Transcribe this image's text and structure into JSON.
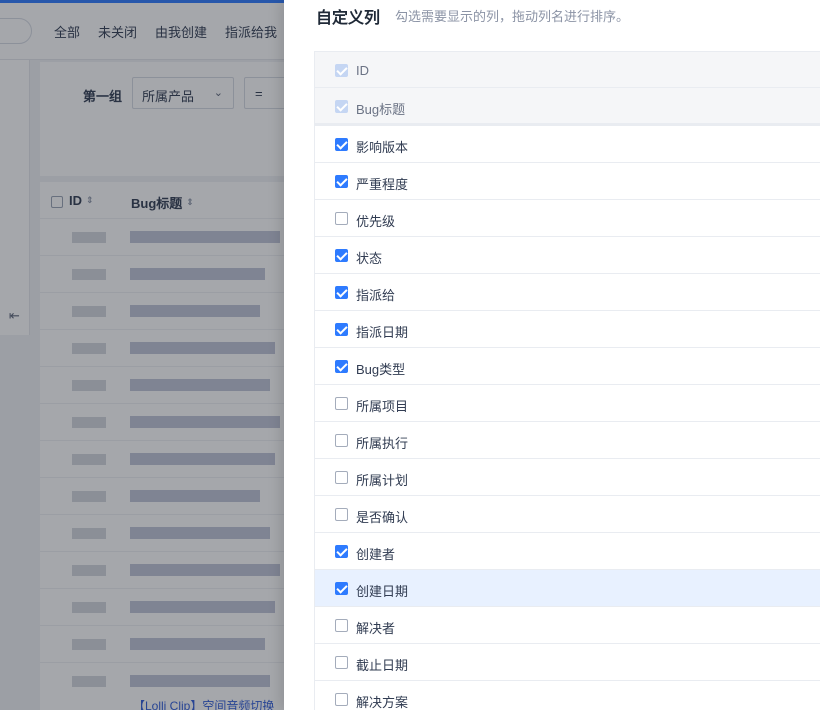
{
  "background": {
    "nav": [
      "全部",
      "未关闭",
      "由我创建",
      "指派给我"
    ],
    "filter": {
      "group_label": "第一组",
      "field_value": "所属产品",
      "operator_value": "="
    },
    "table": {
      "col_id": "ID",
      "col_title": "Bug标题",
      "last_row_title": "【Lolli Clip】空间音频切换"
    }
  },
  "drawer": {
    "title": "自定义列",
    "hint": "勾选需要显示的列，拖动列名进行排序。",
    "columns": [
      {
        "label": "ID",
        "checked": true,
        "fixed": true
      },
      {
        "label": "Bug标题",
        "checked": true,
        "fixed": true
      },
      {
        "label": "影响版本",
        "checked": true
      },
      {
        "label": "严重程度",
        "checked": true
      },
      {
        "label": "优先级",
        "checked": false
      },
      {
        "label": "状态",
        "checked": true
      },
      {
        "label": "指派给",
        "checked": true
      },
      {
        "label": "指派日期",
        "checked": true
      },
      {
        "label": "Bug类型",
        "checked": true
      },
      {
        "label": "所属项目",
        "checked": false
      },
      {
        "label": "所属执行",
        "checked": false
      },
      {
        "label": "所属计划",
        "checked": false
      },
      {
        "label": "是否确认",
        "checked": false
      },
      {
        "label": "创建者",
        "checked": true
      },
      {
        "label": "创建日期",
        "checked": true,
        "hover": true
      },
      {
        "label": "解决者",
        "checked": false
      },
      {
        "label": "截止日期",
        "checked": false
      },
      {
        "label": "解决方案",
        "checked": false
      }
    ]
  },
  "colors": {
    "accent": "#2e7bff",
    "hover_row": "#e8f1ff"
  }
}
